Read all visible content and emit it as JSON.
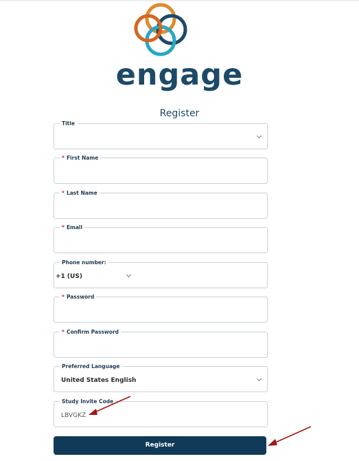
{
  "brand": {
    "name": "engage",
    "ring_colors": [
      "#e08a2c",
      "#1c4a68",
      "#28a6c7",
      "#d4661e"
    ]
  },
  "form": {
    "title": "Register",
    "fields": {
      "title": {
        "label": "Title",
        "value": ""
      },
      "first_name": {
        "label": "First Name",
        "required": "*",
        "value": ""
      },
      "last_name": {
        "label": "Last Name",
        "required": "*",
        "value": ""
      },
      "email": {
        "label": "Email",
        "required": "*",
        "value": ""
      },
      "phone": {
        "label": "Phone number:",
        "country_code": "+1 (US)",
        "value": ""
      },
      "password": {
        "label": "Password",
        "required": "*",
        "value": ""
      },
      "confirm_password": {
        "label": "Confirm Password",
        "required": "*",
        "value": ""
      },
      "preferred_language": {
        "label": "Preferred Language",
        "value": "United States English"
      },
      "invite_code": {
        "label": "Study Invite Code",
        "value": "LBVGKZ"
      }
    },
    "submit_label": "Register"
  },
  "colors": {
    "primary": "#103a57",
    "required": "#c62828",
    "annotation_arrow": "#a31515"
  }
}
